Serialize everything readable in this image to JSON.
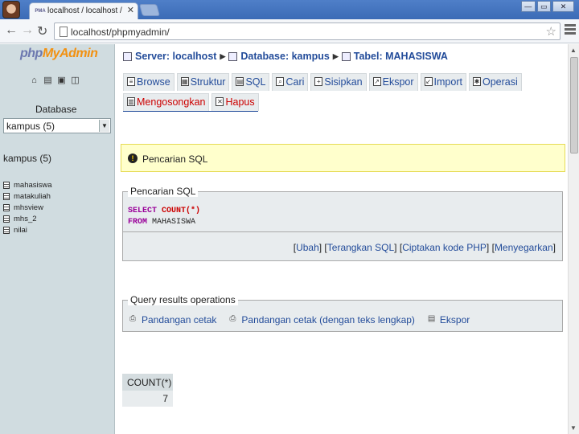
{
  "browser": {
    "tab_title": "localhost / localhost / kampus",
    "tab_favicon": "PMA",
    "tab_close": "✕",
    "url": "localhost/phpmyadmin/",
    "window_buttons": [
      "—",
      "▭",
      "✕"
    ]
  },
  "sidebar": {
    "logo": {
      "php": "php",
      "my": "My",
      "admin": "Admin"
    },
    "nav_icons": [
      "home-icon",
      "sql-icon",
      "docs-icon",
      "query-window-icon"
    ],
    "database_label": "Database",
    "database_select_value": "kampus (5)",
    "db_title": "kampus (5)",
    "tables": [
      "mahasiswa",
      "matakuliah",
      "mhsview",
      "mhs_2",
      "nilai"
    ]
  },
  "breadcrumb": {
    "server": "Server: localhost",
    "database": "Database: kampus",
    "table": "Tabel: MAHASISWA"
  },
  "tabs_row1": [
    {
      "label": "Browse",
      "icon": "browse-icon"
    },
    {
      "label": "Struktur",
      "icon": "structure-icon"
    },
    {
      "label": "SQL",
      "icon": "sql-icon"
    },
    {
      "label": "Cari",
      "icon": "search-icon"
    },
    {
      "label": "Sisipkan",
      "icon": "insert-icon"
    },
    {
      "label": "Ekspor",
      "icon": "export-icon"
    },
    {
      "label": "Import",
      "icon": "import-icon"
    },
    {
      "label": "Operasi",
      "icon": "operations-icon"
    }
  ],
  "tabs_row2": [
    {
      "label": "Mengosongkan",
      "icon": "empty-icon"
    },
    {
      "label": "Hapus",
      "icon": "drop-icon"
    }
  ],
  "notice": {
    "text": "Pencarian SQL"
  },
  "sql_query": {
    "legend": "Pencarian SQL",
    "line1_kw": "SELECT",
    "line1_fn": "COUNT(*)",
    "line2_kw": "FROM",
    "line2_rest": "MAHASISWA",
    "links": [
      "Ubah",
      "Terangkan SQL",
      "Ciptakan kode PHP",
      "Menyegarkan"
    ]
  },
  "query_results": {
    "legend": "Query results operations",
    "ops": [
      "Pandangan cetak",
      "Pandangan cetak (dengan teks lengkap)",
      "Ekspor"
    ]
  },
  "result": {
    "header": "COUNT(*)",
    "value": "7"
  },
  "colors": {
    "link": "#234c9a",
    "danger": "#cc0000",
    "sidebar_bg": "#d0dce0",
    "notice_bg": "#ffffcc"
  }
}
